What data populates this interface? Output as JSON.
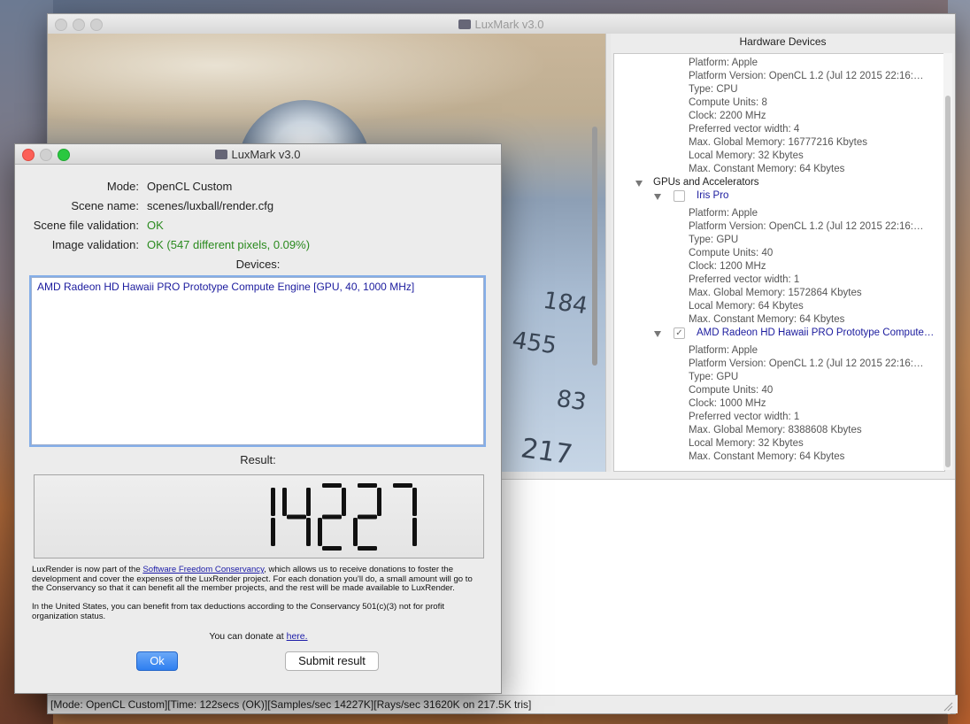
{
  "main_window": {
    "title": "LuxMark v3.0",
    "hardware_header": "Hardware Devices",
    "render_tiles": [
      "184",
      "455",
      "83",
      "217"
    ],
    "tree": {
      "cpu_lines": [
        "Platform: Apple",
        "Platform Version: OpenCL 1.2 (Jul 12 2015 22:16:…",
        "Type: CPU",
        "Compute Units: 8",
        "Clock: 2200 MHz",
        "Preferred vector width: 4",
        "Max. Global Memory: 16777216 Kbytes",
        "Local Memory: 32 Kbytes",
        "Max. Constant Memory: 64 Kbytes"
      ],
      "gpu_group_label": "GPUs and Accelerators",
      "iris": {
        "name": "Iris Pro",
        "checked": false,
        "lines": [
          "Platform: Apple",
          "Platform Version: OpenCL 1.2 (Jul 12 2015 22:16:…",
          "Type: GPU",
          "Compute Units: 40",
          "Clock: 1200 MHz",
          "Preferred vector width: 1",
          "Max. Global Memory: 1572864 Kbytes",
          "Local Memory: 64 Kbytes",
          "Max. Constant Memory: 64 Kbytes"
        ]
      },
      "amd": {
        "name": "AMD Radeon HD Hawaii PRO Prototype Compute…",
        "checked": true,
        "lines": [
          "Platform: Apple",
          "Platform Version: OpenCL 1.2 (Jul 12 2015 22:16:…",
          "Type: GPU",
          "Compute Units: 40",
          "Clock: 1000 MHz",
          "Preferred vector width: 1",
          "Max. Global Memory: 8388608 Kbytes",
          "Local Memory: 32 Kbytes",
          "Max. Constant Memory: 64 Kbytes"
        ]
      }
    },
    "status_bar": "[Mode: OpenCL Custom][Time: 122secs (OK)][Samples/sec  14227K][Rays/sec  31620K on 217.5K tris]"
  },
  "dialog": {
    "title": "LuxMark v3.0",
    "fields": [
      {
        "label": "Mode:",
        "value": "OpenCL Custom"
      },
      {
        "label": "Scene name:",
        "value": "scenes/luxball/render.cfg"
      },
      {
        "label": "Scene file validation:",
        "value": "OK"
      },
      {
        "label": "Image validation:",
        "value": "OK (547 different pixels, 0.09%)"
      }
    ],
    "devices_label": "Devices:",
    "devices": [
      "AMD Radeon HD Hawaii PRO Prototype Compute Engine [GPU, 40, 1000 MHz]"
    ],
    "result_label": "Result:",
    "result_value": "14227",
    "info": {
      "p1_before": "LuxRender is now part of the ",
      "p1_link": "Software Freedom Conservancy",
      "p1_after": ", which allows us to receive donations to foster the development and cover the expenses of the LuxRender project. For each donation you'll do, a small amount will go to the Conservancy so that it can benefit all the member projects, and the rest will be made available to LuxRender.",
      "p2": "In the United States, you can benefit from tax deductions according to the Conservancy 501(c)(3) not for profit organization status.",
      "donate_before": "You can donate at ",
      "donate_link": "here."
    },
    "ok_label": "Ok",
    "submit_label": "Submit result"
  },
  "colors": {
    "link_blue": "#1b1ba8",
    "ok_green": "#2a8a1e",
    "lcd_black": "#111111",
    "button_blue": "#2e7ff0"
  }
}
